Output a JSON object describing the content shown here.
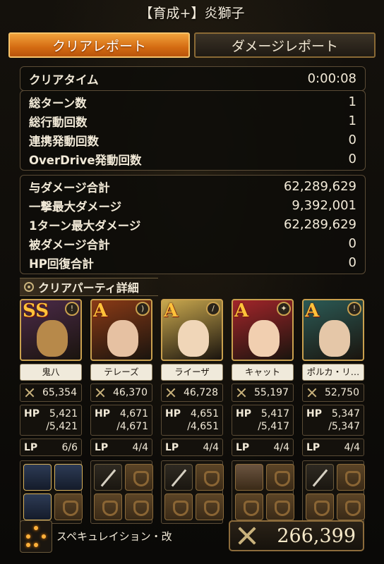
{
  "title": "【育成+】炎獅子",
  "tabs": [
    {
      "label": "クリアレポート",
      "active": true
    },
    {
      "label": "ダメージレポート",
      "active": false
    }
  ],
  "clear_time": {
    "label": "クリアタイム",
    "value": "0:00:08"
  },
  "counts": [
    {
      "label": "総ターン数",
      "value": "1"
    },
    {
      "label": "総行動回数",
      "value": "1"
    },
    {
      "label": "連携発動回数",
      "value": "0"
    },
    {
      "label": "OverDrive発動回数",
      "value": "0"
    }
  ],
  "damage": [
    {
      "label": "与ダメージ合計",
      "value": "62,289,629"
    },
    {
      "label": "一撃最大ダメージ",
      "value": "9,392,001"
    },
    {
      "label": "1ターン最大ダメージ",
      "value": "62,289,629"
    },
    {
      "label": "被ダメージ合計",
      "value": "0"
    },
    {
      "label": "HP回復合計",
      "value": "0"
    }
  ],
  "party_header": "クリアパーティ詳細",
  "party": [
    {
      "rank": "SS",
      "name": "鬼八",
      "power": "65,354",
      "hp": "5,421",
      "hp_max": "/5,421",
      "lp": "6/6",
      "hp_label": "HP",
      "lp_label": "LP",
      "face_color": "#b7894a",
      "bg_color": "#4b2a48"
    },
    {
      "rank": "A",
      "name": "テレーズ",
      "power": "46,370",
      "hp": "4,671",
      "hp_max": "/4,671",
      "lp": "4/4",
      "hp_label": "HP",
      "lp_label": "LP",
      "face_color": "#e6c1a2",
      "bg_color": "#8a3a16"
    },
    {
      "rank": "A",
      "name": "ライーザ",
      "power": "46,728",
      "hp": "4,651",
      "hp_max": "/4,651",
      "lp": "4/4",
      "hp_label": "HP",
      "lp_label": "LP",
      "face_color": "#f0d6b8",
      "bg_color": "#c9a84e"
    },
    {
      "rank": "A",
      "name": "キャット",
      "power": "55,197",
      "hp": "5,417",
      "hp_max": "/5,417",
      "lp": "4/4",
      "hp_label": "HP",
      "lp_label": "LP",
      "face_color": "#f1cfb0",
      "bg_color": "#a2252a"
    },
    {
      "rank": "A",
      "name": "ポルカ・リ…",
      "power": "52,750",
      "hp": "5,347",
      "hp_max": "/5,347",
      "lp": "4/4",
      "hp_label": "HP",
      "lp_label": "LP",
      "face_color": "#e5c7a8",
      "bg_color": "#2b5a55"
    }
  ],
  "footer": {
    "formation": "スペキュレイション・改",
    "total_power": "266,399"
  }
}
